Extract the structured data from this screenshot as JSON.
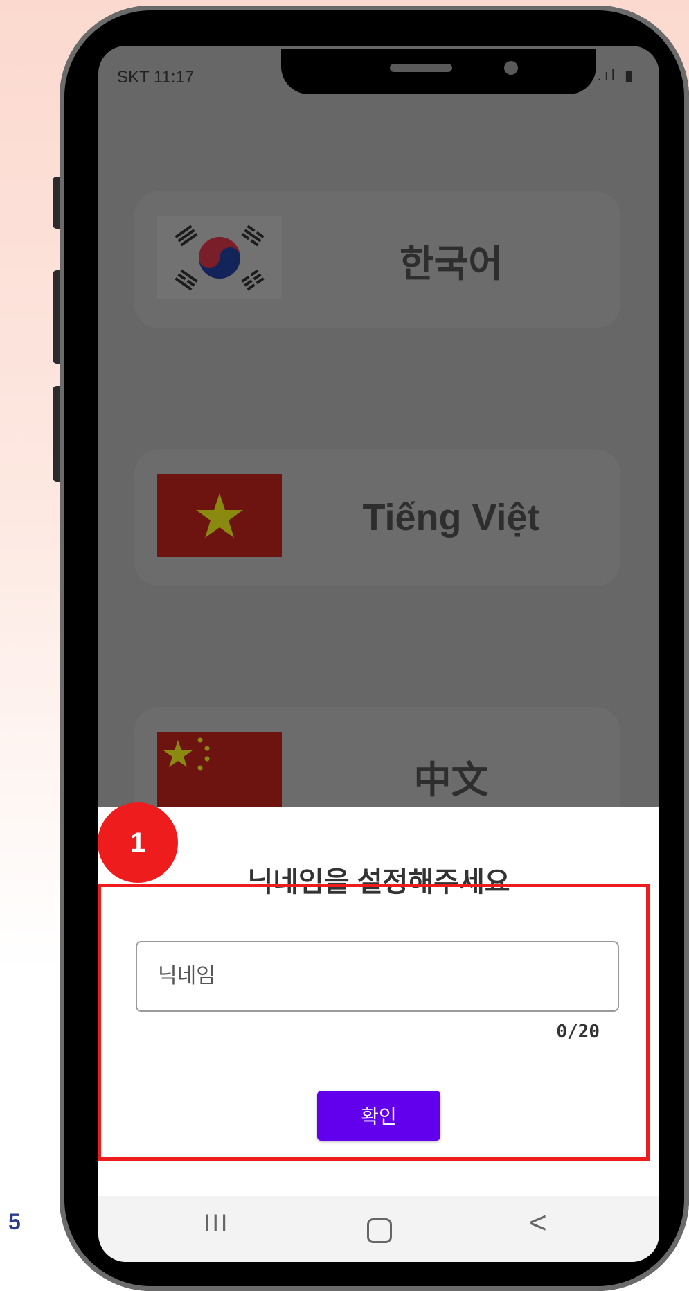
{
  "page_number": "5",
  "status_bar": {
    "carrier_time": "SKT 11:17",
    "icons": [
      "mute-icon",
      "5g-icon",
      "signal-icon",
      "battery-icon"
    ],
    "icons_text": "🔇 ⁵ᴳ .ıl ▮"
  },
  "languages": [
    {
      "label": "한국어",
      "flag": "korea-flag-icon"
    },
    {
      "label": "Tiếng Việt",
      "flag": "vietnam-flag-icon"
    },
    {
      "label": "中文",
      "flag": "china-flag-icon"
    }
  ],
  "dialog": {
    "title": "닉네임을 설정해주세요",
    "input_placeholder": "닉네임",
    "input_value": "",
    "counter": "0/20",
    "confirm_label": "확인"
  },
  "nav": {
    "recent": "III",
    "back": "<"
  },
  "annotation": {
    "step": "1",
    "color": "#ee1c1c"
  },
  "colors": {
    "accent": "#6200ee",
    "highlight": "#ee1c1c",
    "page_number": "#2c3a8c"
  }
}
